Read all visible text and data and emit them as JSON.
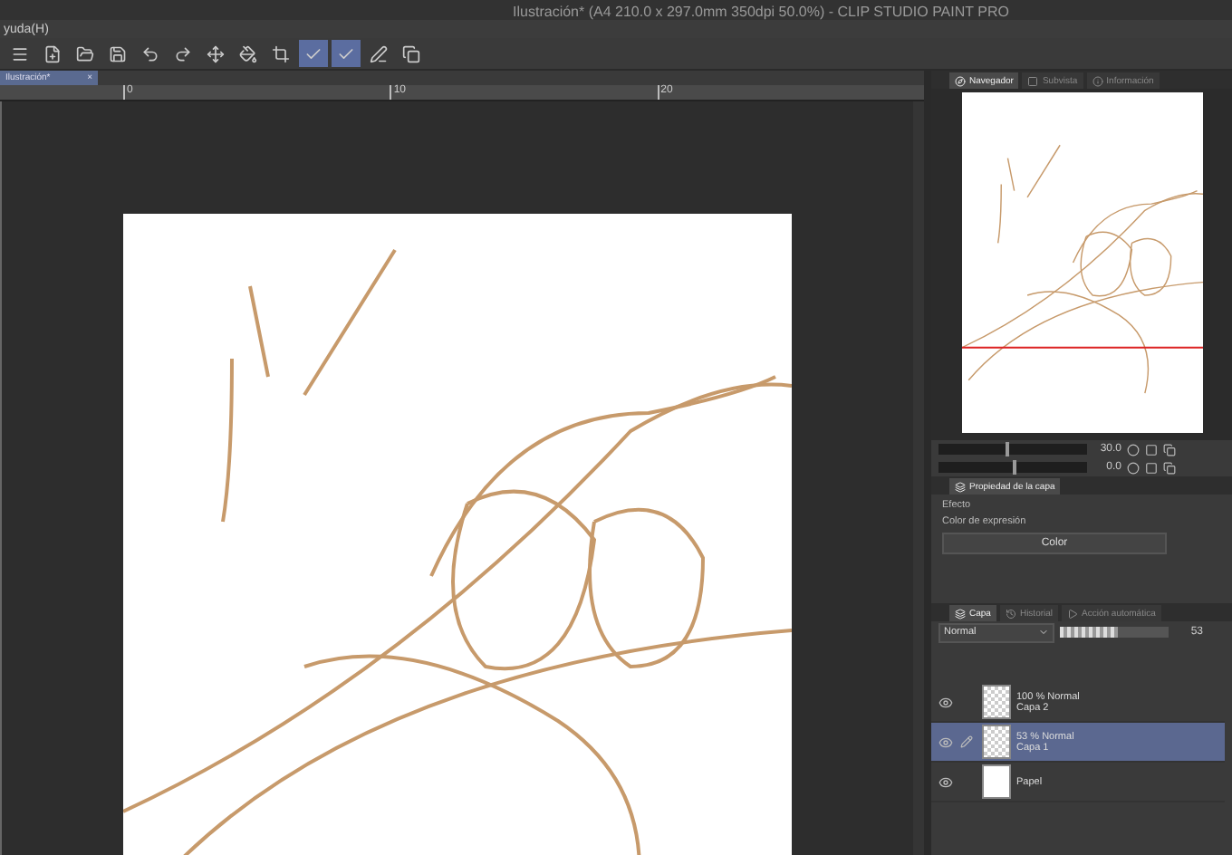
{
  "window": {
    "title": "Ilustración* (A4 210.0 x 297.0mm 350dpi 50.0%) - CLIP STUDIO PAINT PRO"
  },
  "menu": [
    "yuda(H)"
  ],
  "toolbar": [
    {
      "kind": "menu",
      "selected": false
    },
    {
      "kind": "new",
      "selected": false
    },
    {
      "kind": "open",
      "selected": false
    },
    {
      "kind": "save",
      "selected": false
    },
    {
      "kind": "undo",
      "selected": false
    },
    {
      "kind": "redo",
      "selected": false
    },
    {
      "kind": "transform",
      "selected": false
    },
    {
      "kind": "fill",
      "selected": false
    },
    {
      "kind": "crop",
      "selected": false
    },
    {
      "kind": "snap",
      "selected": true
    },
    {
      "kind": "snap",
      "selected": true
    },
    {
      "kind": "pen",
      "selected": false
    },
    {
      "kind": "copy",
      "selected": false
    }
  ],
  "document_tab": {
    "label": "Ilustración*",
    "close": "×"
  },
  "ruler": {
    "marks": [
      "0",
      "10",
      "20"
    ]
  },
  "navigator": {
    "tabs": [
      {
        "label": "Navegador",
        "selected": true
      },
      {
        "label": "Subvista",
        "selected": false
      },
      {
        "label": "Información",
        "selected": false
      }
    ],
    "zoom_slider": {
      "level": 0.45,
      "reading": "30.0"
    },
    "rotate_slider": {
      "level": 0.5,
      "reading": "0.0"
    }
  },
  "layer_property": {
    "tab": "Propiedad de la capa",
    "effect_label": "Efecto",
    "color_label": "Color de expresión",
    "color_value": "Color"
  },
  "layers_panel": {
    "tabs": [
      {
        "label": "Capa",
        "selected": true
      },
      {
        "label": "Historial",
        "selected": false
      },
      {
        "label": "Acción automática",
        "selected": false
      }
    ],
    "blend_mode": "Normal",
    "opacity": {
      "level": 0.53,
      "reading": "53"
    },
    "layers": [
      {
        "kind": "raster",
        "mode": "100 % Normal",
        "name": "Capa 2",
        "visible": true,
        "selected": false,
        "editing": false
      },
      {
        "kind": "raster",
        "mode": "53 % Normal",
        "name": "Capa 1",
        "visible": true,
        "selected": true,
        "editing": true
      },
      {
        "kind": "paper",
        "name": "Papel",
        "visible": true,
        "selected": false,
        "editing": false
      }
    ]
  }
}
